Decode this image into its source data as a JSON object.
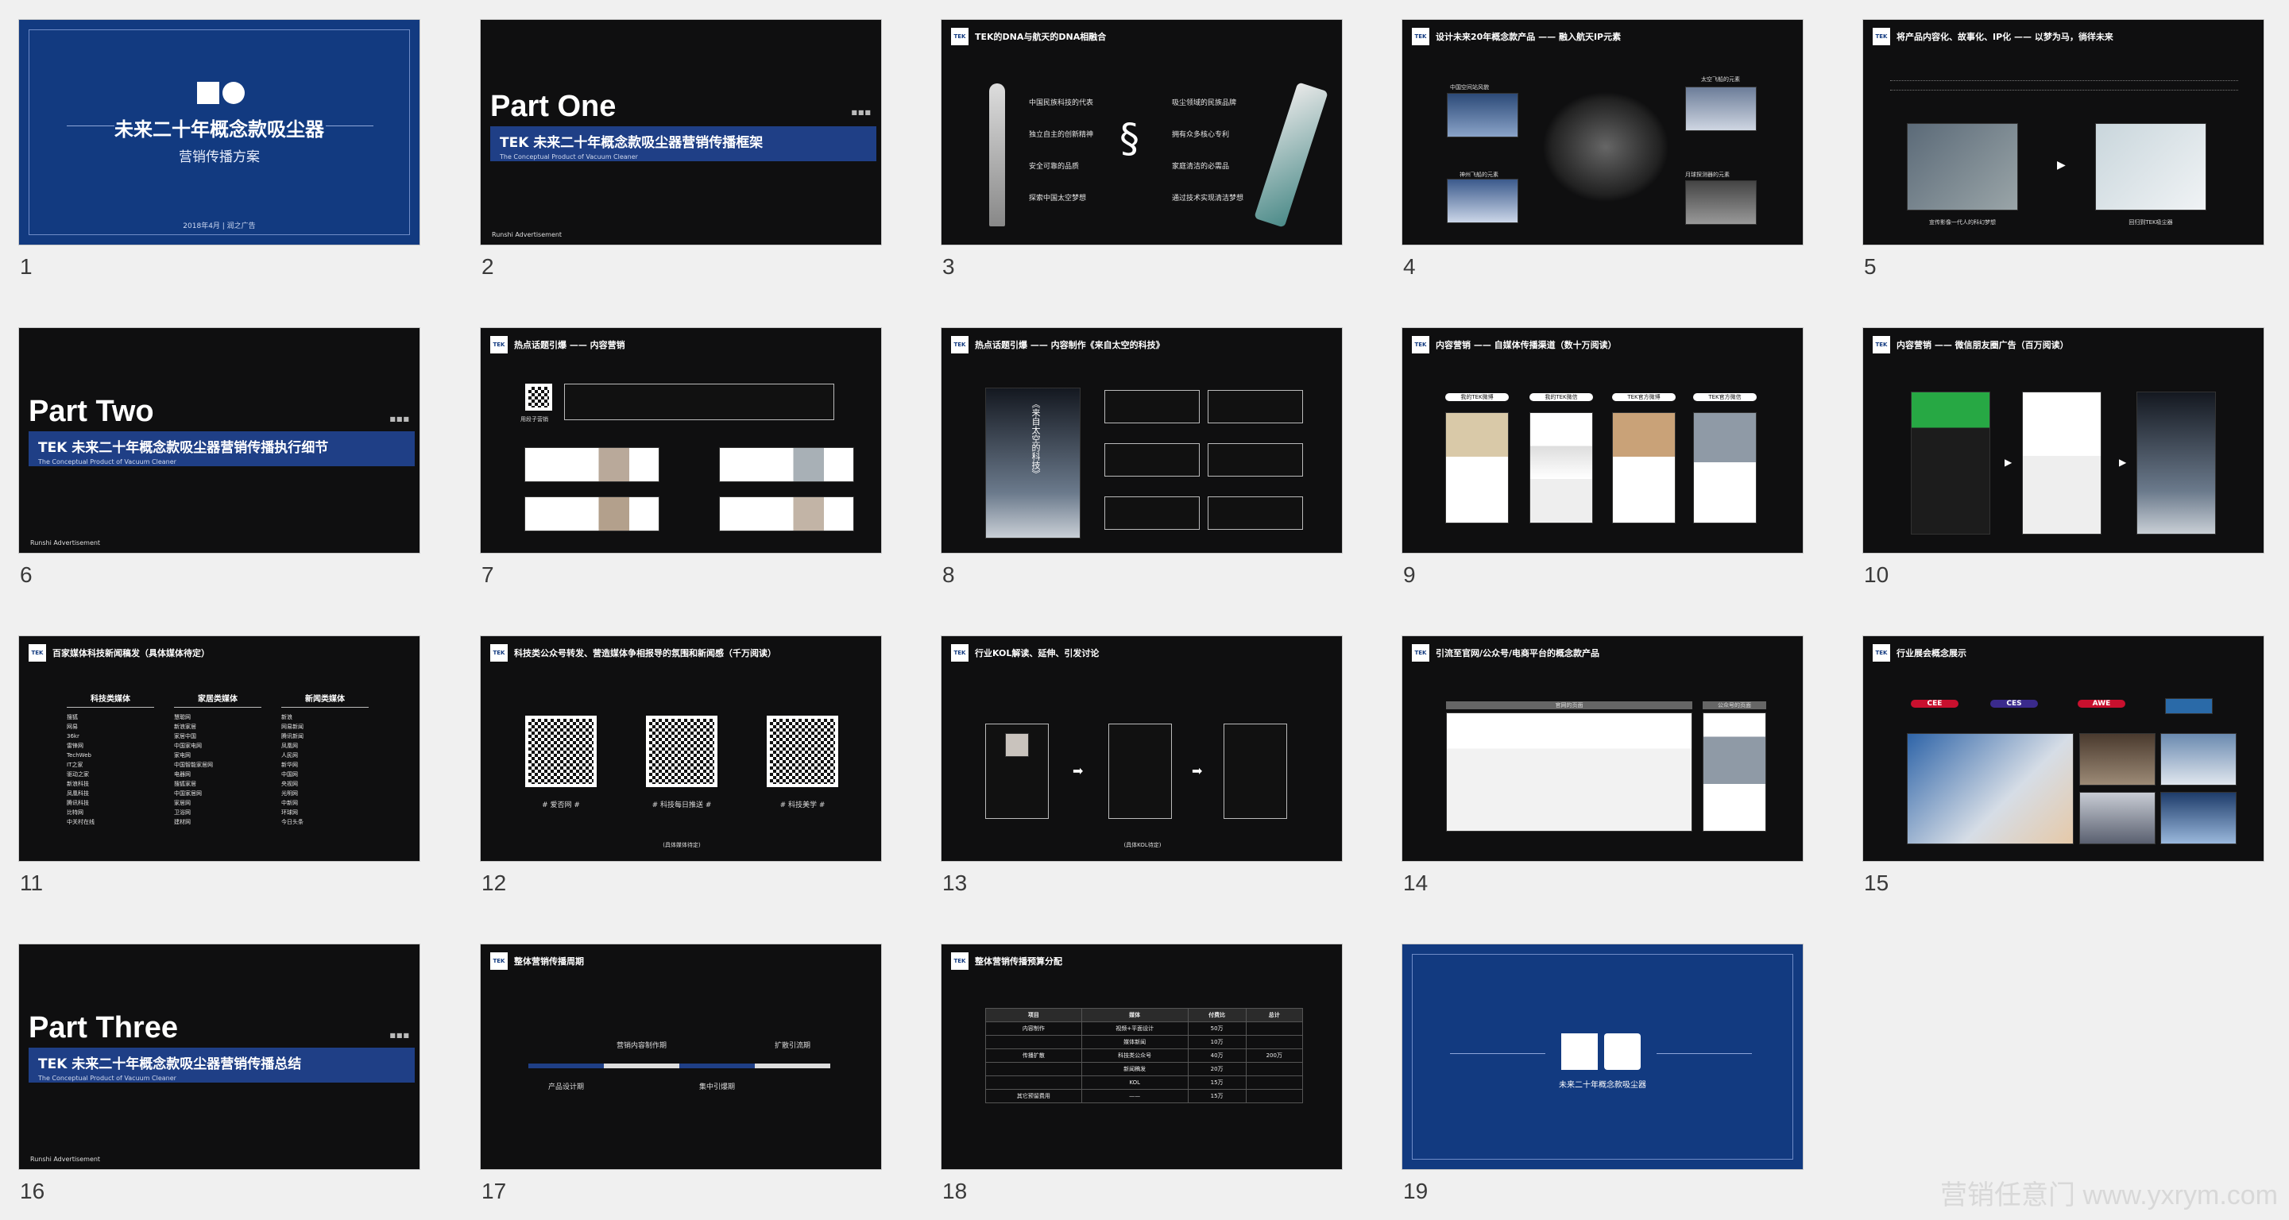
{
  "slides": [
    {
      "number": "1",
      "title": "未来二十年概念款吸尘器",
      "subtitle": "营销传播方案",
      "date": "2018年4月 | 润之广告",
      "logo": "TEK"
    },
    {
      "number": "2",
      "part": "Part One",
      "bar_title": "TEK 未来二十年概念款吸尘器营销传播框架",
      "bar_sub": "The Conceptual Product of Vacuum Cleaner",
      "footer": "Runshi Advertisement"
    },
    {
      "number": "3",
      "header": "TEK的DNA与航天的DNA相融合",
      "left_items": [
        "中国民族科技的代表",
        "独立自主的创新精神",
        "安全可靠的品质",
        "探索中国太空梦想"
      ],
      "right_items": [
        "吸尘领域的民族品牌",
        "拥有众多核心专利",
        "家庭清洁的必需品",
        "通过技术实现清洁梦想"
      ]
    },
    {
      "number": "4",
      "header": "设计未来20年概念款产品 —— 融入航天IP元素",
      "labels": [
        "中国空间站风貌",
        "太空飞船的元素",
        "神州飞船的元素",
        "月球探测器的元素"
      ]
    },
    {
      "number": "5",
      "header": "将产品内容化、故事化、IP化 —— 以梦为马，徜徉未来",
      "captions": [
        "宣传影像一代人的科幻梦想",
        "回归到TEK吸尘器"
      ]
    },
    {
      "number": "6",
      "part": "Part Two",
      "bar_title": "TEK 未来二十年概念款吸尘器营销传播执行细节",
      "bar_sub": "The Conceptual Product of Vacuum Cleaner",
      "footer": "Runshi Advertisement"
    },
    {
      "number": "7",
      "header": "热点话题引爆 —— 内容营销",
      "source": "用段子营销"
    },
    {
      "number": "8",
      "header": "热点话题引爆 —— 内容制作《来自太空的科技》",
      "panel_text": "《来自太空的科技》"
    },
    {
      "number": "9",
      "header": "内容营销 —— 自媒体传播渠道（数十万阅读）",
      "tabs": [
        "我的TEK微博",
        "我的TEK微信",
        "TEK官方微博",
        "TEK官方微信"
      ]
    },
    {
      "number": "10",
      "header": "内容营销 —— 微信朋友圈广告（百万阅读）"
    },
    {
      "number": "11",
      "header": "百家媒体科技新闻稿发（具体媒体待定）",
      "columns": [
        {
          "name": "科技类媒体",
          "items": [
            "搜狐",
            "网易",
            "36kr",
            "雷锋网",
            "TechWeb",
            "IT之家",
            "驱动之家",
            "新浪科技",
            "凤凰科技",
            "腾讯科技",
            "比特网",
            "中关村在线"
          ]
        },
        {
          "name": "家居类媒体",
          "items": [
            "慧聪网",
            "新浪家居",
            "家居中国",
            "中国家电网",
            "家电网",
            "中国智能家居网",
            "电器网",
            "搜狐家居",
            "中国家居网",
            "家居网",
            "卫浴网",
            "建材网"
          ]
        },
        {
          "name": "新闻类媒体",
          "items": [
            "新浪",
            "网易新闻",
            "腾讯新闻",
            "凤凰网",
            "人民网",
            "新华网",
            "中国网",
            "央视网",
            "光明网",
            "中新网",
            "环球网",
            "今日头条"
          ]
        }
      ]
    },
    {
      "number": "12",
      "header": "科技类公众号转发、营造媒体争相报导的氛围和新闻感（千万阅读）",
      "accounts": [
        {
          "name": "# 爱否网 #"
        },
        {
          "name": "# 科技每日推送 #"
        },
        {
          "name": "# 科技美学 #"
        }
      ],
      "note": "(具体媒体待定)"
    },
    {
      "number": "13",
      "header": "行业KOL解读、延伸、引发讨论",
      "note": "(具体KOL待定)"
    },
    {
      "number": "14",
      "header": "引流至官网/公众号/电商平台的概念款产品",
      "labels": [
        "官网的页面",
        "公众号的页面"
      ]
    },
    {
      "number": "15",
      "header": "行业展会概念展示",
      "brands": [
        "CEE",
        "CES",
        "AWE"
      ]
    },
    {
      "number": "16",
      "part": "Part Three",
      "bar_title": "TEK 未来二十年概念款吸尘器营销传播总结",
      "bar_sub": "The Conceptual Product of Vacuum Cleaner",
      "footer": "Runshi Advertisement"
    },
    {
      "number": "17",
      "header": "整体营销传播周期",
      "stages": [
        "产品设计期",
        "营销内容制作期",
        "集中引爆期",
        "扩散引流期"
      ]
    },
    {
      "number": "18",
      "header": "整体营销传播预算分配",
      "table_headers": [
        "项目",
        "媒体",
        "付费比",
        "总计"
      ],
      "rows": [
        [
          "内容制作",
          "视频+平面设计",
          "50万",
          ""
        ],
        [
          "",
          "媒体新闻",
          "10万",
          ""
        ],
        [
          "传播扩散",
          "科技类公众号",
          "40万",
          "200万"
        ],
        [
          "",
          "新闻稿发",
          "20万",
          ""
        ],
        [
          "",
          "KOL",
          "15万",
          ""
        ],
        [
          "其它预留费用",
          "——",
          "15万",
          ""
        ]
      ]
    },
    {
      "number": "19",
      "title": "未来二十年概念款吸尘器",
      "logo": "TEK"
    }
  ],
  "watermark": "营销任意门 www.yxrym.com"
}
